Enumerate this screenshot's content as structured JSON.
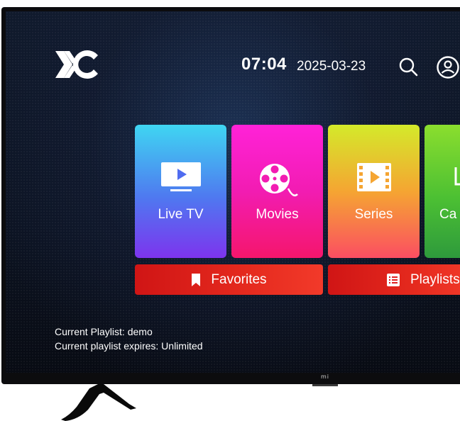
{
  "header": {
    "time": "07:04",
    "date": "2025-03-23",
    "search_icon": "search-icon",
    "profile_icon": "user-circle-icon"
  },
  "tiles": [
    {
      "label": "Live TV",
      "icon": "tv-play-icon"
    },
    {
      "label": "Movies",
      "icon": "film-reel-icon"
    },
    {
      "label": "Series",
      "icon": "film-strip-icon"
    },
    {
      "label": "Ca",
      "icon": "clock-icon"
    }
  ],
  "buttons": {
    "favorites": "Favorites",
    "playlists": "Playlists"
  },
  "info": {
    "playlist_key": "Current Playlist:",
    "playlist_value": "demo",
    "expires_key": "Current playlist expires:",
    "expires_value": "Unlimited"
  },
  "tv": {
    "brand": "mi"
  },
  "colors": {
    "live_tv": "#4f78f0",
    "movies": "#f21cb2",
    "series": "#f5a532",
    "catchup": "#4cc033",
    "button_red": "#e02020"
  }
}
